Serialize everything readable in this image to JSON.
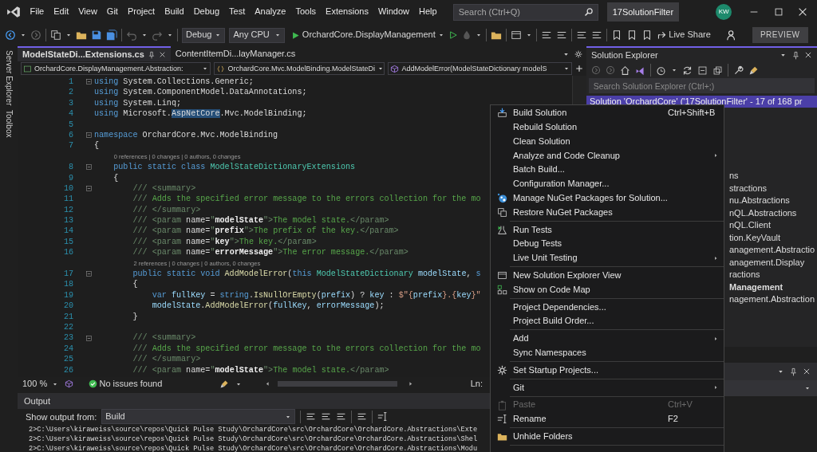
{
  "menu_bar": {
    "items": [
      "File",
      "Edit",
      "View",
      "Git",
      "Project",
      "Build",
      "Debug",
      "Test",
      "Analyze",
      "Tools",
      "Extensions",
      "Window",
      "Help"
    ],
    "search": {
      "placeholder": "Search (Ctrl+Q)"
    },
    "solution_name": "17SolutionFilter",
    "avatar": "KW"
  },
  "toolbar": {
    "configuration": "Debug",
    "platform": "Any CPU",
    "startup_project": "OrchardCore.DisplayManagement",
    "live_share": "Live Share",
    "preview": "PREVIEW"
  },
  "side_tabs": [
    "Server Explorer",
    "Toolbox"
  ],
  "editor": {
    "tabs": [
      {
        "label": "ModelStateDi...Extensions.cs",
        "selected": true
      },
      {
        "label": "ContentItemDi...layManager.cs",
        "selected": false
      }
    ],
    "navigation": [
      "OrchardCore.DisplayManagement.Abstraction:",
      "OrchardCore.Mvc.ModelBinding.ModelStateDi",
      "AddModelError(ModelStateDictionary modelS"
    ],
    "lines": [
      {
        "kind": "block",
        "num": "1",
        "t": [
          {
            "text": "using ",
            "kind": "kw"
          },
          {
            "text": "System.Collections.Generic;",
            "kind": "tx"
          }
        ]
      },
      {
        "kind": "code",
        "num": "2",
        "t": [
          {
            "text": "using ",
            "kind": "kw"
          },
          {
            "text": "System.ComponentModel.DataAnnotations;",
            "kind": "tx"
          }
        ]
      },
      {
        "kind": "code",
        "num": "3",
        "t": [
          {
            "text": "using ",
            "kind": "kw"
          },
          {
            "text": "System.Linq;",
            "kind": "tx"
          }
        ]
      },
      {
        "kind": "code",
        "num": "4",
        "t": [
          {
            "text": "using ",
            "kind": "kw"
          },
          {
            "text": "Microsoft.",
            "kind": "tx"
          },
          {
            "text": "AspNetCore",
            "kind": "hl"
          },
          {
            "text": ".Mvc.ModelBinding;",
            "kind": "tx"
          }
        ]
      },
      {
        "kind": "code",
        "num": "5"
      },
      {
        "kind": "block",
        "num": "6",
        "t": [
          {
            "text": "namespace ",
            "kind": "kw"
          },
          {
            "text": "OrchardCore.Mvc.ModelBinding",
            "kind": "tx"
          }
        ]
      },
      {
        "kind": "code",
        "num": "7",
        "t": [
          {
            "text": "{",
            "kind": "tx"
          }
        ]
      },
      {
        "kind": "lens",
        "text": "    0 references | 0 changes | 0 authors, 0 changes"
      },
      {
        "kind": "block",
        "num": "8",
        "t": [
          {
            "text": "    public static class ",
            "kind": "kw"
          },
          {
            "text": "ModelStateDictionaryExtensions",
            "kind": "ty"
          }
        ]
      },
      {
        "kind": "code",
        "num": "9",
        "t": [
          {
            "text": "    {",
            "kind": "tx"
          }
        ]
      },
      {
        "kind": "block",
        "num": "10",
        "t": [
          {
            "text": "        /// <summary>",
            "kind": "doc"
          }
        ]
      },
      {
        "kind": "code",
        "num": "11",
        "t": [
          {
            "text": "        /// ",
            "kind": "doc"
          },
          {
            "text": "Adds the specified error message to the errors collection for the mo",
            "kind": "cm"
          }
        ]
      },
      {
        "kind": "code",
        "num": "12",
        "t": [
          {
            "text": "        /// </summary>",
            "kind": "doc"
          }
        ]
      },
      {
        "kind": "code",
        "num": "13",
        "t": [
          {
            "text": "        /// <param ",
            "kind": "doc"
          },
          {
            "text": "name=",
            "kind": "tx"
          },
          {
            "text": "\"",
            "kind": "doc"
          },
          {
            "text": "modelState",
            "kind": "attr"
          },
          {
            "text": "\">",
            "kind": "doc"
          },
          {
            "text": "The model state.",
            "kind": "cm"
          },
          {
            "text": "</param>",
            "kind": "doc"
          }
        ]
      },
      {
        "kind": "code",
        "num": "14",
        "t": [
          {
            "text": "        /// <param ",
            "kind": "doc"
          },
          {
            "text": "name=",
            "kind": "tx"
          },
          {
            "text": "\"",
            "kind": "doc"
          },
          {
            "text": "prefix",
            "kind": "attr"
          },
          {
            "text": "\">",
            "kind": "doc"
          },
          {
            "text": "The prefix of the key.",
            "kind": "cm"
          },
          {
            "text": "</param>",
            "kind": "doc"
          }
        ]
      },
      {
        "kind": "code",
        "num": "15",
        "t": [
          {
            "text": "        /// <param ",
            "kind": "doc"
          },
          {
            "text": "name=",
            "kind": "tx"
          },
          {
            "text": "\"",
            "kind": "doc"
          },
          {
            "text": "key",
            "kind": "attr"
          },
          {
            "text": "\">",
            "kind": "doc"
          },
          {
            "text": "The key.",
            "kind": "cm"
          },
          {
            "text": "</param>",
            "kind": "doc"
          }
        ]
      },
      {
        "kind": "code",
        "num": "16",
        "t": [
          {
            "text": "        /// <param ",
            "kind": "doc"
          },
          {
            "text": "name=",
            "kind": "tx"
          },
          {
            "text": "\"",
            "kind": "doc"
          },
          {
            "text": "errorMessage",
            "kind": "attr"
          },
          {
            "text": "\">",
            "kind": "doc"
          },
          {
            "text": "The error message.",
            "kind": "cm"
          },
          {
            "text": "</param>",
            "kind": "doc"
          }
        ]
      },
      {
        "kind": "lens",
        "text": "        2 references | 0 changes | 0 authors, 0 changes"
      },
      {
        "kind": "block",
        "num": "17",
        "t": [
          {
            "text": "        public static void ",
            "kind": "kw"
          },
          {
            "text": "AddModelError",
            "kind": "mt"
          },
          {
            "text": "(",
            "kind": "tx"
          },
          {
            "text": "this ",
            "kind": "kw"
          },
          {
            "text": "ModelStateDictionary ",
            "kind": "ty"
          },
          {
            "text": "modelState",
            "kind": "par"
          },
          {
            "text": ", ",
            "kind": "tx"
          },
          {
            "text": "s",
            "kind": "kw"
          }
        ]
      },
      {
        "kind": "code",
        "num": "18",
        "t": [
          {
            "text": "        {",
            "kind": "tx"
          }
        ]
      },
      {
        "kind": "code",
        "num": "19",
        "t": [
          {
            "text": "            var ",
            "kind": "kw"
          },
          {
            "text": "fullKey",
            "kind": "par"
          },
          {
            "text": " = ",
            "kind": "tx"
          },
          {
            "text": "string",
            "kind": "kw"
          },
          {
            "text": ".",
            "kind": "tx"
          },
          {
            "text": "IsNullOrEmpty",
            "kind": "mt"
          },
          {
            "text": "(",
            "kind": "tx"
          },
          {
            "text": "prefix",
            "kind": "par"
          },
          {
            "text": ") ? ",
            "kind": "tx"
          },
          {
            "text": "key",
            "kind": "par"
          },
          {
            "text": " : ",
            "kind": "tx"
          },
          {
            "text": "$\"{",
            "kind": "str"
          },
          {
            "text": "prefix",
            "kind": "par"
          },
          {
            "text": "}.{",
            "kind": "str"
          },
          {
            "text": "key",
            "kind": "par"
          },
          {
            "text": "}\"",
            "kind": "str"
          }
        ]
      },
      {
        "kind": "code",
        "num": "20",
        "t": [
          {
            "text": "            modelState",
            "kind": "par"
          },
          {
            "text": ".",
            "kind": "tx"
          },
          {
            "text": "AddModelError",
            "kind": "mt"
          },
          {
            "text": "(",
            "kind": "tx"
          },
          {
            "text": "fullKey",
            "kind": "par"
          },
          {
            "text": ", ",
            "kind": "tx"
          },
          {
            "text": "errorMessage",
            "kind": "par"
          },
          {
            "text": ");",
            "kind": "tx"
          }
        ]
      },
      {
        "kind": "code",
        "num": "21",
        "t": [
          {
            "text": "        }",
            "kind": "tx"
          }
        ]
      },
      {
        "kind": "code",
        "num": "22"
      },
      {
        "kind": "block",
        "num": "23",
        "t": [
          {
            "text": "        /// <summary>",
            "kind": "doc"
          }
        ]
      },
      {
        "kind": "code",
        "num": "24",
        "t": [
          {
            "text": "        /// ",
            "kind": "doc"
          },
          {
            "text": "Adds the specified error message to the errors collection for the mo",
            "kind": "cm"
          }
        ]
      },
      {
        "kind": "code",
        "num": "25",
        "t": [
          {
            "text": "        /// </summary>",
            "kind": "doc"
          }
        ]
      },
      {
        "kind": "code",
        "num": "26",
        "t": [
          {
            "text": "        /// <param ",
            "kind": "doc"
          },
          {
            "text": "name=",
            "kind": "tx"
          },
          {
            "text": "\"",
            "kind": "doc"
          },
          {
            "text": "modelState",
            "kind": "attr"
          },
          {
            "text": "\">",
            "kind": "doc"
          },
          {
            "text": "The model state.",
            "kind": "cm"
          },
          {
            "text": "</param>",
            "kind": "doc"
          }
        ]
      }
    ],
    "status": {
      "zoom": "100 %",
      "issues": "No issues found",
      "position": "Ln:"
    }
  },
  "output": {
    "title": "Output",
    "source_label": "Show output from:",
    "source": "Build",
    "lines": [
      "2>C:\\Users\\kiraweiss\\source\\repos\\Quick Pulse Study\\OrchardCore\\src\\OrchardCore\\OrchardCore.Abstractions\\Exte",
      "2>C:\\Users\\kiraweiss\\source\\repos\\Quick Pulse Study\\OrchardCore\\src\\OrchardCore\\OrchardCore.Abstractions\\Shel",
      "2>C:\\Users\\kiraweiss\\source\\repos\\Quick Pulse Study\\OrchardCore\\src\\OrchardCore\\OrchardCore.Abstractions\\Modu"
    ]
  },
  "solution_explorer": {
    "title": "Solution Explorer",
    "search": {
      "placeholder": "Search Solution Explorer (Ctrl+;)"
    },
    "root": {
      "label": "Solution 'OrchardCore' ('17SolutionFilter' - 17 of 168 pr",
      "selected": true
    },
    "items": [
      {
        "label": "ns",
        "startup": false
      },
      {
        "label": "stractions",
        "startup": false
      },
      {
        "label": "nu.Abstractions",
        "startup": false
      },
      {
        "label": "nQL.Abstractions",
        "startup": false
      },
      {
        "label": "nQL.Client",
        "startup": false
      },
      {
        "label": "tion.KeyVault",
        "startup": false
      },
      {
        "label": "anagement.Abstractio",
        "startup": false
      },
      {
        "label": "anagement.Display",
        "startup": false
      },
      {
        "label": "ractions",
        "startup": false
      },
      {
        "label": "Management",
        "startup": true
      },
      {
        "label": "nagement.Abstraction",
        "startup": false
      }
    ]
  },
  "context_menu": {
    "items": [
      {
        "kind": "command",
        "label": "Build Solution",
        "shortcut": "Ctrl+Shift+B",
        "submenu": false,
        "disabled": false
      },
      {
        "kind": "command",
        "label": "Rebuild Solution",
        "submenu": false,
        "disabled": false
      },
      {
        "kind": "command",
        "label": "Clean Solution",
        "submenu": false,
        "disabled": false
      },
      {
        "kind": "command",
        "label": "Analyze and Code Cleanup",
        "submenu": true,
        "disabled": false
      },
      {
        "kind": "command",
        "label": "Batch Build...",
        "submenu": false,
        "disabled": false
      },
      {
        "kind": "command",
        "label": "Configuration Manager...",
        "submenu": false,
        "disabled": false
      },
      {
        "kind": "command",
        "label": "Manage NuGet Packages for Solution...",
        "submenu": false,
        "disabled": false
      },
      {
        "kind": "command",
        "label": "Restore NuGet Packages",
        "submenu": false,
        "disabled": false
      },
      {
        "kind": "separator"
      },
      {
        "kind": "command",
        "label": "Run Tests",
        "submenu": false,
        "disabled": false
      },
      {
        "kind": "command",
        "label": "Debug Tests",
        "submenu": false,
        "disabled": false
      },
      {
        "kind": "command",
        "label": "Live Unit Testing",
        "submenu": true,
        "disabled": false
      },
      {
        "kind": "separator"
      },
      {
        "kind": "command",
        "label": "New Solution Explorer View",
        "submenu": false,
        "disabled": false
      },
      {
        "kind": "command",
        "label": "Show on Code Map",
        "submenu": false,
        "disabled": false
      },
      {
        "kind": "separator"
      },
      {
        "kind": "command",
        "label": "Project Dependencies...",
        "submenu": false,
        "disabled": false
      },
      {
        "kind": "command",
        "label": "Project Build Order...",
        "submenu": false,
        "disabled": false
      },
      {
        "kind": "separator"
      },
      {
        "kind": "command",
        "label": "Add",
        "submenu": true,
        "disabled": false
      },
      {
        "kind": "command",
        "label": "Sync Namespaces",
        "submenu": false,
        "disabled": false
      },
      {
        "kind": "separator"
      },
      {
        "kind": "command",
        "label": "Set Startup Projects...",
        "submenu": false,
        "disabled": false
      },
      {
        "kind": "separator"
      },
      {
        "kind": "command",
        "label": "Git",
        "submenu": true,
        "disabled": false
      },
      {
        "kind": "separator"
      },
      {
        "kind": "command",
        "label": "Paste",
        "shortcut": "Ctrl+V",
        "submenu": false,
        "disabled": true
      },
      {
        "kind": "command",
        "label": "Rename",
        "shortcut": "F2",
        "submenu": false,
        "disabled": false
      },
      {
        "kind": "separator"
      },
      {
        "kind": "command",
        "label": "Unhide Folders",
        "submenu": false,
        "disabled": false
      },
      {
        "kind": "separator"
      }
    ]
  }
}
